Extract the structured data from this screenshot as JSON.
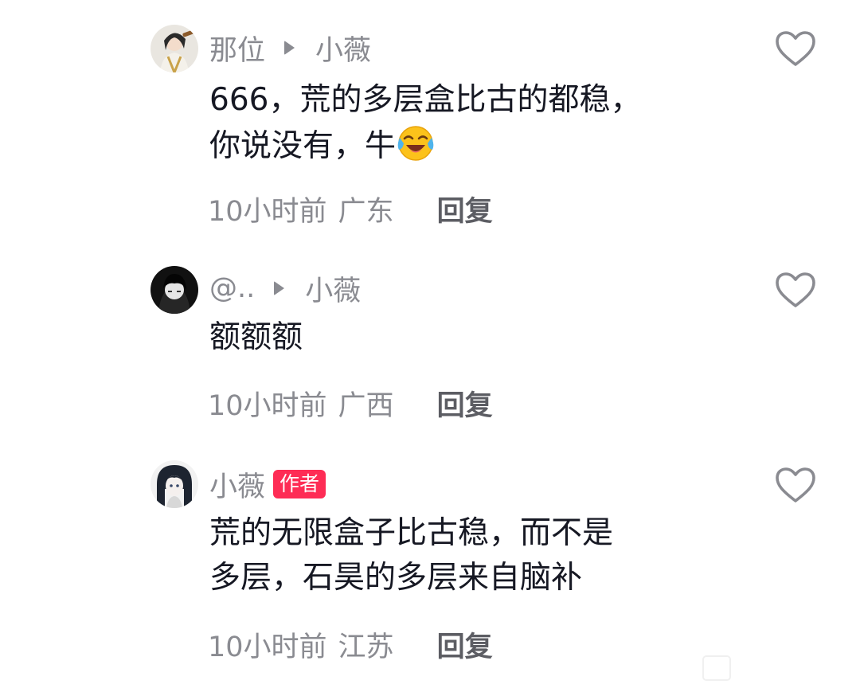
{
  "comments": [
    {
      "username": "那位",
      "reply_to": "小薇",
      "text_line1": "666，荒的多层盒比古的都稳，",
      "text_line2": "你说没有，牛",
      "emoji": "crying-laughing-emoji",
      "time": "10小时前",
      "location": "广东",
      "reply_label": "回复"
    },
    {
      "username": "@..",
      "reply_to": "小薇",
      "text": "额额额",
      "time": "10小时前",
      "location": "广西",
      "reply_label": "回复"
    },
    {
      "username": "小薇",
      "badge": "作者",
      "text_line1": "荒的无限盒子比古稳，而不是",
      "text_line2": "多层，石昊的多层来自脑补",
      "time": "10小时前",
      "location": "江苏",
      "reply_label": "回复"
    }
  ],
  "colors": {
    "secondary_text": "#8a8b91",
    "primary_text": "#161823",
    "author_badge": "#fe2c55",
    "reply_text": "#5c5d63"
  },
  "icons": {
    "like": "heart-outline-icon",
    "reply_arrow": "triangle-right-icon"
  }
}
